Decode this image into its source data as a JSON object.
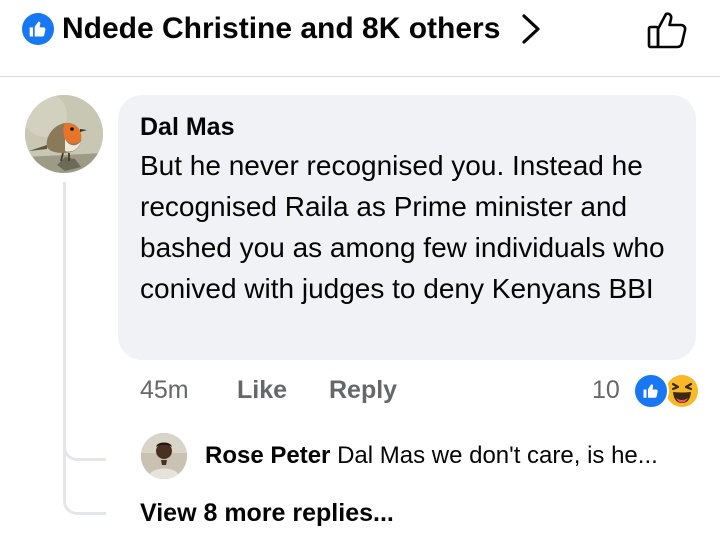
{
  "header": {
    "reactions_summary": "Ndede Christine and 8K others"
  },
  "comment": {
    "author": "Dal Mas",
    "text": "But he never recognised you. Instead he recognised Raila as Prime minister and bashed you as among few individuals who conived with judges to deny Kenyans BBI",
    "time": "45m",
    "like_label": "Like",
    "reply_label": "Reply",
    "reaction_count": "10",
    "reaction_icons": [
      "like-icon",
      "haha-icon"
    ]
  },
  "reply": {
    "author": "Rose Peter",
    "text": "Dal Mas we don't care, is he..."
  },
  "view_more": "View 8 more replies...",
  "colors": {
    "brand_blue": "#1877f2",
    "bubble_bg": "#f0f2f5",
    "secondary_text": "#65676b",
    "haha_yellow": "#f7b928"
  }
}
